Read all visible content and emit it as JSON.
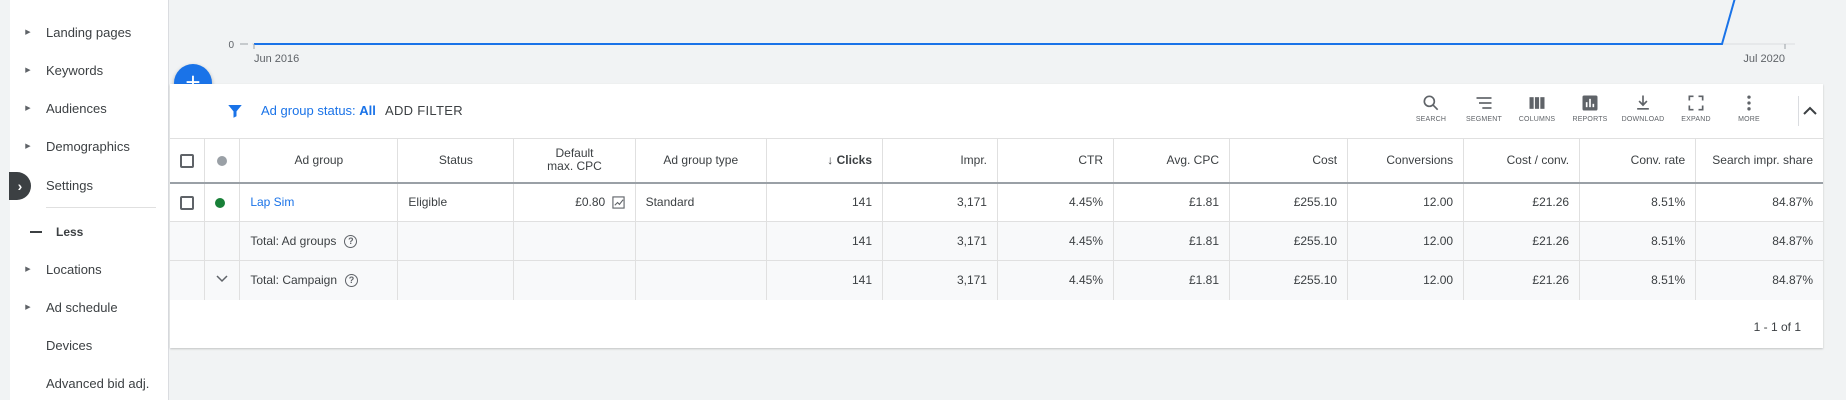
{
  "sidebar": {
    "items": [
      {
        "label": "Landing pages",
        "arrow": true
      },
      {
        "label": "Keywords",
        "arrow": true
      },
      {
        "label": "Audiences",
        "arrow": true
      },
      {
        "label": "Demographics",
        "arrow": true
      },
      {
        "label": "Settings",
        "arrow": false
      },
      {
        "label": "Locations",
        "arrow": true
      },
      {
        "label": "Ad schedule",
        "arrow": true
      },
      {
        "label": "Devices",
        "arrow": false
      },
      {
        "label": "Advanced bid adj.",
        "arrow": false
      }
    ],
    "less_label": "Less"
  },
  "chart": {
    "y_tick": "0",
    "x_start": "Jun 2016",
    "x_end": "Jul 2020",
    "line_color": "#1a73e8"
  },
  "toolbar": {
    "filter_prefix": "Ad group status: ",
    "filter_value": "All",
    "add_filter": "ADD FILTER",
    "tools": [
      {
        "label": "SEARCH",
        "icon": "search-icon"
      },
      {
        "label": "SEGMENT",
        "icon": "segment-icon"
      },
      {
        "label": "COLUMNS",
        "icon": "columns-icon"
      },
      {
        "label": "REPORTS",
        "icon": "reports-icon"
      },
      {
        "label": "DOWNLOAD",
        "icon": "download-icon"
      },
      {
        "label": "EXPAND",
        "icon": "expand-icon"
      },
      {
        "label": "MORE",
        "icon": "more-vert-icon"
      }
    ]
  },
  "table": {
    "headers": {
      "ad_group": "Ad group",
      "status": "Status",
      "default_cpc_line1": "Default",
      "default_cpc_line2": "max. CPC",
      "ad_group_type": "Ad group type",
      "clicks": "Clicks",
      "impr": "Impr.",
      "ctr": "CTR",
      "avg_cpc": "Avg. CPC",
      "cost": "Cost",
      "conversions": "Conversions",
      "cost_per_conv": "Cost / conv.",
      "conv_rate": "Conv. rate",
      "search_impr_share": "Search impr. share"
    },
    "row": {
      "ad_group": "Lap Sim",
      "status": "Eligible",
      "default_cpc": "£0.80",
      "ad_group_type": "Standard",
      "clicks": "141",
      "impr": "3,171",
      "ctr": "4.45%",
      "avg_cpc": "£1.81",
      "cost": "£255.10",
      "conversions": "12.00",
      "cost_per_conv": "£21.26",
      "conv_rate": "8.51%",
      "search_impr_share": "84.87%",
      "status_color": "#188038"
    },
    "total_ad_groups": {
      "label": "Total: Ad groups",
      "clicks": "141",
      "impr": "3,171",
      "ctr": "4.45%",
      "avg_cpc": "£1.81",
      "cost": "£255.10",
      "conversions": "12.00",
      "cost_per_conv": "£21.26",
      "conv_rate": "8.51%",
      "search_impr_share": "84.87%"
    },
    "total_campaign": {
      "label": "Total: Campaign",
      "clicks": "141",
      "impr": "3,171",
      "ctr": "4.45%",
      "avg_cpc": "£1.81",
      "cost": "£255.10",
      "conversions": "12.00",
      "cost_per_conv": "£21.26",
      "conv_rate": "8.51%",
      "search_impr_share": "84.87%"
    },
    "pagination": "1 - 1 of 1"
  }
}
